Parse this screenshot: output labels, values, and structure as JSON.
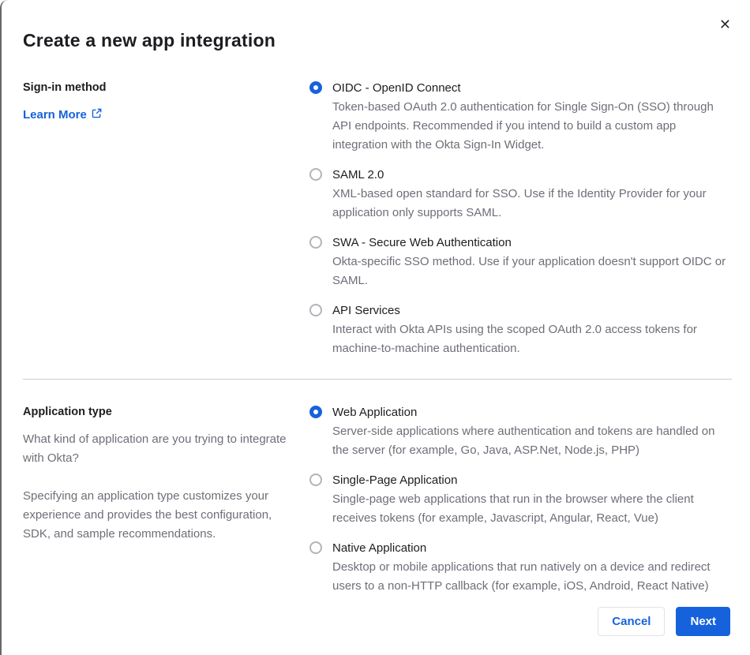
{
  "modal": {
    "title": "Create a new app integration",
    "close_glyph": "✕"
  },
  "signin_section": {
    "label": "Sign-in method",
    "learn_more": "Learn More",
    "options": [
      {
        "label": "OIDC - OpenID Connect",
        "description": "Token-based OAuth 2.0 authentication for Single Sign-On (SSO) through API endpoints. Recommended if you intend to build a custom app integration with the Okta Sign-In Widget.",
        "selected": true
      },
      {
        "label": "SAML 2.0",
        "description": "XML-based open standard for SSO. Use if the Identity Provider for your application only supports SAML.",
        "selected": false
      },
      {
        "label": "SWA - Secure Web Authentication",
        "description": "Okta-specific SSO method. Use if your application doesn't support OIDC or SAML.",
        "selected": false
      },
      {
        "label": "API Services",
        "description": "Interact with Okta APIs using the scoped OAuth 2.0 access tokens for machine-to-machine authentication.",
        "selected": false
      }
    ]
  },
  "apptype_section": {
    "label": "Application type",
    "helper1": "What kind of application are you trying to integrate with Okta?",
    "helper2": "Specifying an application type customizes your experience and provides the best configuration, SDK, and sample recommendations.",
    "options": [
      {
        "label": "Web Application",
        "description": "Server-side applications where authentication and tokens are handled on the server (for example, Go, Java, ASP.Net, Node.js, PHP)",
        "selected": true
      },
      {
        "label": "Single-Page Application",
        "description": "Single-page web applications that run in the browser where the client receives tokens (for example, Javascript, Angular, React, Vue)",
        "selected": false
      },
      {
        "label": "Native Application",
        "description": "Desktop or mobile applications that run natively on a device and redirect users to a non-HTTP callback (for example, iOS, Android, React Native)",
        "selected": false
      }
    ]
  },
  "footer": {
    "cancel_label": "Cancel",
    "next_label": "Next"
  },
  "colors": {
    "accent_blue": "#1662dd",
    "text_dark": "#1d1d21",
    "text_gray": "#6e6e78",
    "divider": "#cfcfd4",
    "radio_unselected_border": "#b3b3bb"
  }
}
